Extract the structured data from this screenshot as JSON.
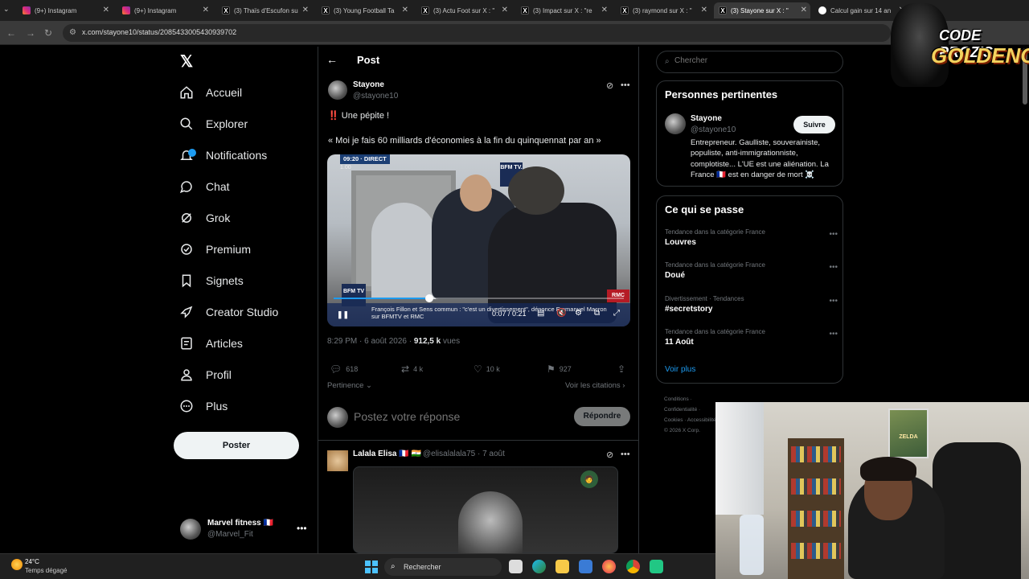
{
  "browser": {
    "tabs": [
      {
        "label": "(9+) Instagram",
        "icon": "instagram"
      },
      {
        "label": "(9+) Instagram",
        "icon": "instagram"
      },
      {
        "label": "(3) Thaïs d'Escufon su",
        "icon": "x"
      },
      {
        "label": "(3) Young Football Ta",
        "icon": "x"
      },
      {
        "label": "(3) Actu Foot sur X : \"",
        "icon": "x"
      },
      {
        "label": "(3) Impact sur X : \"re",
        "icon": "x"
      },
      {
        "label": "(3) raymond sur X : \"",
        "icon": "x"
      },
      {
        "label": "(3) Stayone sur X : \"",
        "icon": "x"
      },
      {
        "label": "Calcul gain sur 14 an",
        "icon": "google"
      }
    ],
    "url": "x.com/stayone10/status/2085433005430939702"
  },
  "nav": {
    "items": [
      {
        "label": "Accueil",
        "icon": "home-icon"
      },
      {
        "label": "Explorer",
        "icon": "search-icon"
      },
      {
        "label": "Notifications",
        "icon": "bell-icon"
      },
      {
        "label": "Chat",
        "icon": "chat-icon"
      },
      {
        "label": "Grok",
        "icon": "grok-icon"
      },
      {
        "label": "Premium",
        "icon": "premium-icon"
      },
      {
        "label": "Signets",
        "icon": "bookmark-icon"
      },
      {
        "label": "Creator Studio",
        "icon": "rocket-icon"
      },
      {
        "label": "Articles",
        "icon": "article-icon"
      },
      {
        "label": "Profil",
        "icon": "person-icon"
      },
      {
        "label": "Plus",
        "icon": "more-icon"
      }
    ],
    "post_button": "Poster",
    "account": {
      "name": "Marvel fitness 🇫🇷",
      "handle": "@Marvel_Fit"
    }
  },
  "post": {
    "header": "Post",
    "author": {
      "name": "Stayone",
      "handle": "@stayone10"
    },
    "text_line1": "‼️ Une pépite !",
    "text_line2": "« Moi je fais 60 milliards d'économies à la fin du quinquennat par an »",
    "video": {
      "live_badge": "09:20 · DIRECT",
      "speed": "1.00",
      "channel": "BFM TV.",
      "partner": "RMC",
      "ticker_logo": "BFM TV",
      "caption": "François Fillon et Sens commun : \"c'est un divertissement\", dénonce Emmanuel Macron sur BFMTV et RMC",
      "time": "0:07 / 0:21",
      "progress": 0.33
    },
    "timestamp": "8:29 PM · 6 août 2026 · ",
    "views": "912,5 k",
    "views_label": " vues",
    "actions": {
      "replies": "618",
      "reposts": "4 k",
      "likes": "10 k",
      "bookmarks": "927"
    },
    "sort_label": "Pertinence",
    "citations_label": "Voir les citations",
    "reply_placeholder": "Postez votre réponse",
    "reply_button": "Répondre"
  },
  "reply": {
    "name": "Lalala Elisa 🇫🇷 🇮🇳",
    "handle": "@elisalalala75 · 7 août",
    "media_badge": "🧑"
  },
  "sidebar": {
    "search_placeholder": "Chercher",
    "relevant": {
      "title": "Personnes pertinentes",
      "name": "Stayone",
      "handle": "@stayone10",
      "follow": "Suivre",
      "bio": "Entrepreneur. Gaulliste, souverainiste, populiste, anti-immigrationniste, complotiste... L'UE est une aliénation. La France 🇫🇷 est en danger de mort ☠️"
    },
    "trends": {
      "title": "Ce qui se passe",
      "items": [
        {
          "context": "Tendance dans la catégorie France",
          "topic": "Louvres"
        },
        {
          "context": "Tendance dans la catégorie France",
          "topic": "Doué"
        },
        {
          "context": "Divertissement · Tendances",
          "topic": "#secretstory"
        },
        {
          "context": "Tendance dans la catégorie France",
          "topic": "11 Août"
        }
      ],
      "see_more": "Voir plus"
    },
    "footer": "Conditions · Confidentialité · Cookies · Accessibilité · © 2026 X Corp."
  },
  "taskbar": {
    "temp": "24°C",
    "weather": "Temps dégagé",
    "search": "Rechercher"
  },
  "overlay": {
    "logo_line1": "CODE PROZIS",
    "logo_line2": "GOLDENG",
    "poster_text": "ZELDA"
  },
  "colors": {
    "accent": "#1d9bf0",
    "background": "#000000",
    "muted": "#71767b"
  }
}
